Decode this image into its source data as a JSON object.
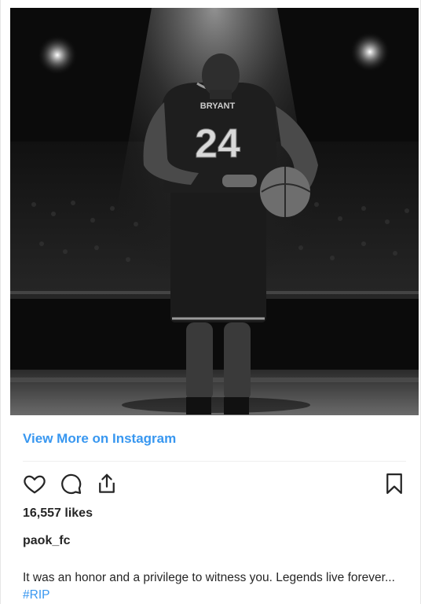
{
  "post": {
    "image_alt": "Basketball player wearing number 24 jersey seen from behind under spotlight",
    "jersey": {
      "name": "BRYANT",
      "number": "24"
    }
  },
  "link": {
    "view_more": "View More on Instagram"
  },
  "actions": {
    "like_icon": "heart-icon",
    "comment_icon": "comment-icon",
    "share_icon": "share-icon",
    "save_icon": "bookmark-icon"
  },
  "likes": "16,557 likes",
  "username": "paok_fc",
  "caption": {
    "text": "It was an honor and a privilege to witness you. Legends live forever... ",
    "hashtag": "#RIP"
  },
  "colors": {
    "link": "#3897f0",
    "text": "#262626"
  }
}
